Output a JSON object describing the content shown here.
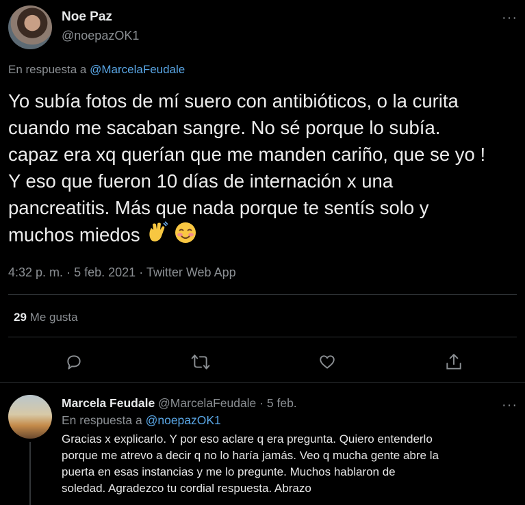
{
  "main_tweet": {
    "name": "Noe Paz",
    "handle": "@noepazOK1",
    "reply_prefix": "En respuesta a",
    "reply_to": "@MarcelaFeudale",
    "text_line1": "Yo subía fotos de mí suero con antibióticos, o la curita",
    "text_line2": "cuando me sacaban sangre. No sé porque lo subía.",
    "text_line3": "capaz era xq querían que me manden cariño, que se yo !",
    "text_line4": "Y eso que fueron 10 días de internación x una",
    "text_line5": "pancreatitis. Más que nada porque te sentís solo y",
    "text_line6": "muchos miedos",
    "emojis": [
      "waving-hand",
      "smiling-face-with-blush"
    ],
    "time": "4:32 p. m.",
    "date": "5 feb. 2021",
    "source": "Twitter Web App",
    "likes_count": "29",
    "likes_label": "Me gusta",
    "more_label": "···",
    "separator": "·"
  },
  "actions": [
    {
      "icon": "reply-icon"
    },
    {
      "icon": "retweet-icon"
    },
    {
      "icon": "like-icon"
    },
    {
      "icon": "share-icon"
    }
  ],
  "reply_tweet": {
    "name": "Marcela Feudale",
    "handle": "@MarcelaFeudale",
    "separator": "·",
    "date": "5 feb.",
    "reply_prefix": "En respuesta a",
    "reply_to": "@noepazOK1",
    "text_line1": "Gracias x explicarlo. Y por eso aclare q era pregunta. Quiero entenderlo",
    "text_line2": "porque me atrevo a decir q no lo haría jamás. Veo q mucha gente abre la",
    "text_line3": "puerta en esas instancias y me lo pregunte. Muchos hablaron de",
    "text_line4": "soledad. Agradezco tu cordial respuesta. Abrazo",
    "more_label": "···"
  },
  "colors": {
    "background": "#000000",
    "link": "#5aa7e6",
    "muted": "#8b8f93",
    "divider": "#2f3336"
  }
}
